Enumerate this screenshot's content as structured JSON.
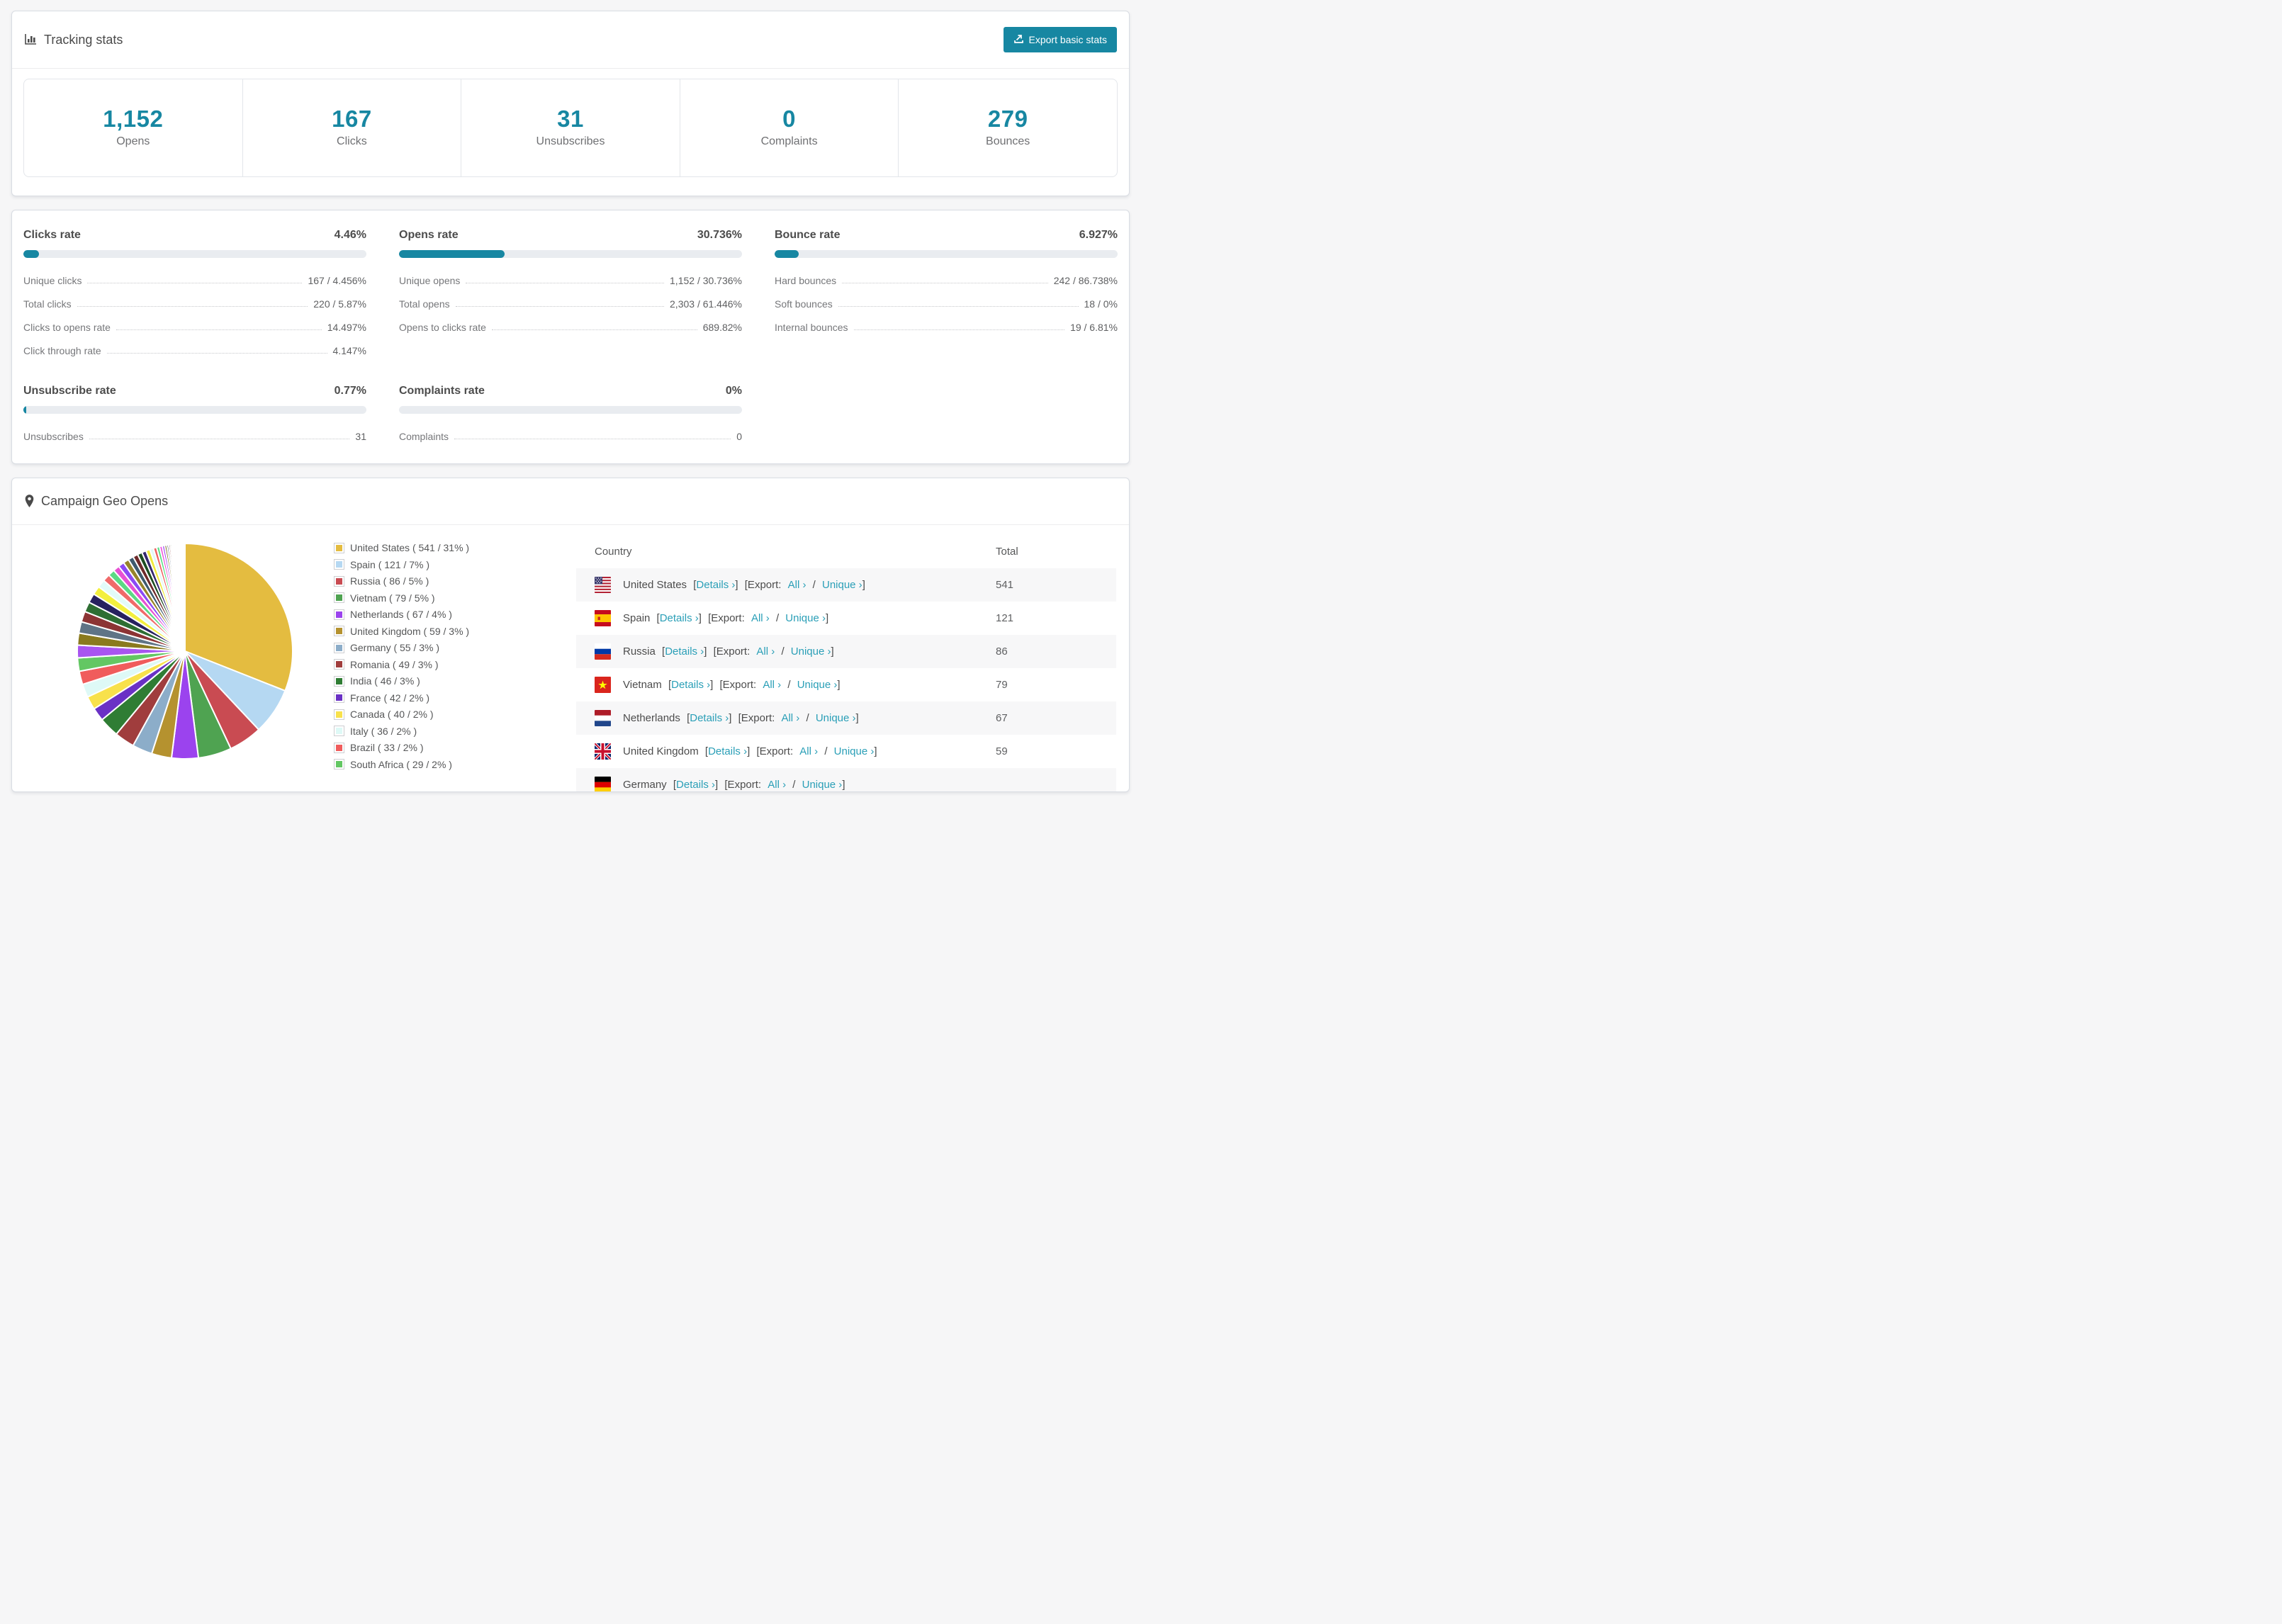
{
  "accent_color": "#1787a2",
  "link_color": "#2a9fb7",
  "tracking": {
    "title": "Tracking stats",
    "export_button": "Export basic stats",
    "stats": [
      {
        "value": "1,152",
        "label": "Opens"
      },
      {
        "value": "167",
        "label": "Clicks"
      },
      {
        "value": "31",
        "label": "Unsubscribes"
      },
      {
        "value": "0",
        "label": "Complaints"
      },
      {
        "value": "279",
        "label": "Bounces"
      }
    ]
  },
  "rates": {
    "clicks": {
      "title": "Clicks rate",
      "value": "4.46%",
      "percent": 4.46,
      "rows": [
        {
          "label": "Unique clicks",
          "value": "167 / 4.456%"
        },
        {
          "label": "Total clicks",
          "value": "220 / 5.87%"
        },
        {
          "label": "Clicks to opens rate",
          "value": "14.497%"
        },
        {
          "label": "Click through rate",
          "value": "4.147%"
        }
      ]
    },
    "opens": {
      "title": "Opens rate",
      "value": "30.736%",
      "percent": 30.736,
      "rows": [
        {
          "label": "Unique opens",
          "value": "1,152 / 30.736%"
        },
        {
          "label": "Total opens",
          "value": "2,303 / 61.446%"
        },
        {
          "label": "Opens to clicks rate",
          "value": "689.82%"
        }
      ]
    },
    "bounce": {
      "title": "Bounce rate",
      "value": "6.927%",
      "percent": 6.927,
      "rows": [
        {
          "label": "Hard bounces",
          "value": "242 / 86.738%"
        },
        {
          "label": "Soft bounces",
          "value": "18 / 0%"
        },
        {
          "label": "Internal bounces",
          "value": "19 / 6.81%"
        }
      ]
    },
    "unsubscribe": {
      "title": "Unsubscribe rate",
      "value": "0.77%",
      "percent": 0.77,
      "rows": [
        {
          "label": "Unsubscribes",
          "value": "31"
        }
      ]
    },
    "complaints": {
      "title": "Complaints rate",
      "value": "0%",
      "percent": 0,
      "rows": [
        {
          "label": "Complaints",
          "value": "0"
        }
      ]
    }
  },
  "geo": {
    "title": "Campaign Geo Opens",
    "chart_data": {
      "type": "pie",
      "title": "Campaign Geo Opens",
      "legend_position": "right",
      "slices": [
        {
          "name": "United States",
          "value": 541,
          "pct": 31,
          "color": "#e4bc40"
        },
        {
          "name": "Spain",
          "value": 121,
          "pct": 7,
          "color": "#b5d8f2"
        },
        {
          "name": "Russia",
          "value": 86,
          "pct": 5,
          "color": "#c94b52"
        },
        {
          "name": "Vietnam",
          "value": 79,
          "pct": 5,
          "color": "#4fa351"
        },
        {
          "name": "Netherlands",
          "value": 67,
          "pct": 4,
          "color": "#9b43ee"
        },
        {
          "name": "United Kingdom",
          "value": 59,
          "pct": 3,
          "color": "#b5922f"
        },
        {
          "name": "Germany",
          "value": 55,
          "pct": 3,
          "color": "#8cadc9"
        },
        {
          "name": "Romania",
          "value": 49,
          "pct": 3,
          "color": "#a03d3d"
        },
        {
          "name": "India",
          "value": 46,
          "pct": 3,
          "color": "#2f7d34"
        },
        {
          "name": "France",
          "value": 42,
          "pct": 2,
          "color": "#6a31c5"
        },
        {
          "name": "Canada",
          "value": 40,
          "pct": 2,
          "color": "#f8e14b"
        },
        {
          "name": "Italy",
          "value": 36,
          "pct": 2,
          "color": "#def9f6"
        },
        {
          "name": "Brazil",
          "value": 33,
          "pct": 2,
          "color": "#f05c5c"
        },
        {
          "name": "South Africa",
          "value": 29,
          "pct": 2,
          "color": "#63c763"
        }
      ],
      "others": [
        {
          "pct": 1.9,
          "color": "#a855f0"
        },
        {
          "pct": 1.8,
          "color": "#8a7a1e"
        },
        {
          "pct": 1.7,
          "color": "#5f7486"
        },
        {
          "pct": 1.6,
          "color": "#8c3434"
        },
        {
          "pct": 1.5,
          "color": "#2e6e33"
        },
        {
          "pct": 1.4,
          "color": "#27215f"
        },
        {
          "pct": 1.3,
          "color": "#f3ef3e"
        },
        {
          "pct": 1.2,
          "color": "#e2fbf9"
        },
        {
          "pct": 1.1,
          "color": "#f06a6a"
        },
        {
          "pct": 1.0,
          "color": "#5cd985"
        },
        {
          "pct": 0.95,
          "color": "#e751d3"
        },
        {
          "pct": 0.9,
          "color": "#8b49f5"
        },
        {
          "pct": 0.85,
          "color": "#97842a"
        },
        {
          "pct": 0.8,
          "color": "#3e5a6e"
        },
        {
          "pct": 0.75,
          "color": "#6e2a2a"
        },
        {
          "pct": 0.7,
          "color": "#1d4d22"
        },
        {
          "pct": 0.65,
          "color": "#35286e"
        },
        {
          "pct": 0.6,
          "color": "#efe93c"
        },
        {
          "pct": 0.55,
          "color": "#dff7f5"
        },
        {
          "pct": 0.5,
          "color": "#ef6161"
        },
        {
          "pct": 0.45,
          "color": "#5adf87"
        },
        {
          "pct": 0.4,
          "color": "#f04fd8"
        },
        {
          "pct": 0.36,
          "color": "#a052f2"
        },
        {
          "pct": 0.32,
          "color": "#7a6b16"
        },
        {
          "pct": 0.28,
          "color": "#4b6375"
        },
        {
          "pct": 0.25,
          "color": "#7e2d2d"
        },
        {
          "pct": 0.22,
          "color": "#285c2c"
        },
        {
          "pct": 0.2,
          "color": "#2c2460"
        },
        {
          "pct": 0.17,
          "color": "#f2ee45"
        },
        {
          "pct": 0.15,
          "color": "#e8fbfa"
        },
        {
          "pct": 0.13,
          "color": "#f06a6a"
        },
        {
          "pct": 0.11,
          "color": "#63d985"
        },
        {
          "pct": 0.1,
          "color": "#ea58d6"
        },
        {
          "pct": 0.08,
          "color": "#9e4ff0"
        },
        {
          "pct": 0.07,
          "color": "#8f7d20"
        },
        {
          "pct": 0.06,
          "color": "#52707f"
        },
        {
          "pct": 0.05,
          "color": "#903b3b"
        },
        {
          "pct": 0.05,
          "color": "#2f6e33"
        },
        {
          "pct": 0.04,
          "color": "#2a2468"
        },
        {
          "pct": 0.04,
          "color": "#f0ec42"
        },
        {
          "pct": 0.03,
          "color": "#ef6565"
        },
        {
          "pct": 0.03,
          "color": "#a858f0"
        }
      ]
    },
    "legend": [
      {
        "label": "United States ( 541 / 31% )"
      },
      {
        "label": "Spain ( 121 / 7% )"
      },
      {
        "label": "Russia ( 86 / 5% )"
      },
      {
        "label": "Vietnam ( 79 / 5% )"
      },
      {
        "label": "Netherlands ( 67 / 4% )"
      },
      {
        "label": "United Kingdom ( 59 / 3% )"
      },
      {
        "label": "Germany ( 55 / 3% )"
      },
      {
        "label": "Romania ( 49 / 3% )"
      },
      {
        "label": "India ( 46 / 3% )"
      },
      {
        "label": "France ( 42 / 2% )"
      },
      {
        "label": "Canada ( 40 / 2% )"
      },
      {
        "label": "Italy ( 36 / 2% )"
      },
      {
        "label": "Brazil ( 33 / 2% )"
      },
      {
        "label": "South Africa ( 29 / 2% )"
      }
    ],
    "table": {
      "headers": {
        "country": "Country",
        "total": "Total"
      },
      "strings": {
        "open": "[",
        "close": "]",
        "details": "Details ›",
        "export": "[Export:",
        "all": "All ›",
        "slash": "/",
        "unique": "Unique ›"
      },
      "rows": [
        {
          "country": "United States",
          "total": "541",
          "flag": "us"
        },
        {
          "country": "Spain",
          "total": "121",
          "flag": "es"
        },
        {
          "country": "Russia",
          "total": "86",
          "flag": "ru"
        },
        {
          "country": "Vietnam",
          "total": "79",
          "flag": "vn"
        },
        {
          "country": "Netherlands",
          "total": "67",
          "flag": "nl"
        },
        {
          "country": "United Kingdom",
          "total": "59",
          "flag": "gb"
        },
        {
          "country": "Germany",
          "total": "",
          "flag": "de"
        }
      ]
    }
  }
}
